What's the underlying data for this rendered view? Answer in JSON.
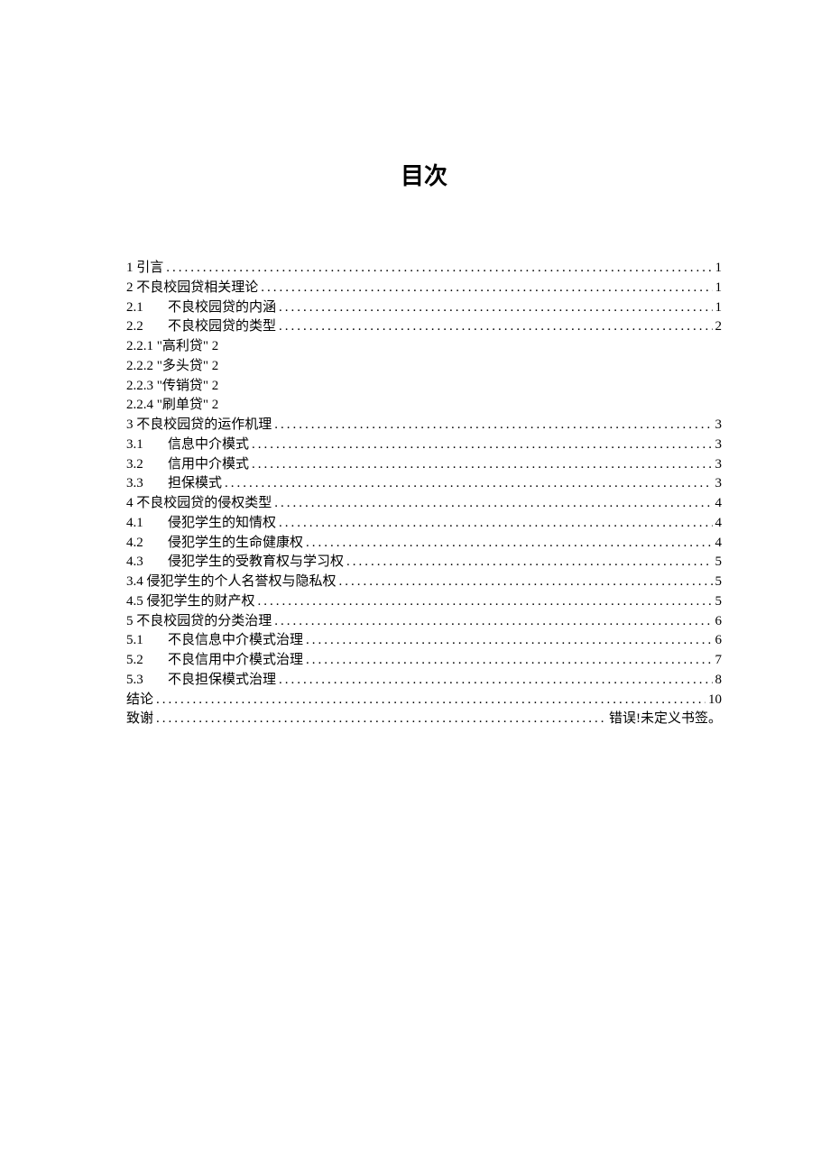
{
  "title": "目次",
  "toc": [
    {
      "label": "1 引言",
      "page": "1",
      "leaders": true
    },
    {
      "label": "2 不良校园贷相关理论",
      "page": "1",
      "leaders": true
    },
    {
      "label_num": "2.1",
      "label_text": "不良校园贷的内涵",
      "page": "1",
      "leaders": true,
      "indent": true
    },
    {
      "label_num": "2.2",
      "label_text": "不良校园贷的类型",
      "page": "2",
      "leaders": true,
      "indent": true
    },
    {
      "label": "2.2.1  \"高利贷\" 2",
      "leaders": false
    },
    {
      "label": "2.2.2  \"多头贷\" 2",
      "leaders": false
    },
    {
      "label": "2.2.3  \"传销贷\" 2",
      "leaders": false
    },
    {
      "label": "2.2.4  \"刷单贷\" 2",
      "leaders": false
    },
    {
      "label": "3 不良校园贷的运作机理",
      "page": "3",
      "leaders": true
    },
    {
      "label_num": "3.1",
      "label_text": "信息中介模式",
      "page": "3",
      "leaders": true,
      "indent": true
    },
    {
      "label_num": "3.2",
      "label_text": "信用中介模式",
      "page": "3",
      "leaders": true,
      "indent": true
    },
    {
      "label_num": "3.3",
      "label_text": "担保模式",
      "page": "3",
      "leaders": true,
      "indent": true
    },
    {
      "label": "4 不良校园贷的侵权类型",
      "page": "4",
      "leaders": true
    },
    {
      "label_num": "4.1",
      "label_text": "侵犯学生的知情权",
      "page": "4",
      "leaders": true,
      "indent": true
    },
    {
      "label_num": "4.2",
      "label_text": "侵犯学生的生命健康权",
      "page": "4",
      "leaders": true,
      "indent": true
    },
    {
      "label_num": "4.3",
      "label_text": "侵犯学生的受教育权与学习权",
      "page": "5",
      "leaders": true,
      "indent": true
    },
    {
      "label": "3.4 侵犯学生的个人名誉权与隐私权",
      "page": "5",
      "leaders": true
    },
    {
      "label": "4.5 侵犯学生的财产权",
      "page": "5",
      "leaders": true
    },
    {
      "label": "5 不良校园贷的分类治理",
      "page": "6",
      "leaders": true
    },
    {
      "label_num": "5.1",
      "label_text": "不良信息中介模式治理",
      "page": "6",
      "leaders": true,
      "indent": true
    },
    {
      "label_num": "5.2",
      "label_text": "不良信用中介模式治理",
      "page": "7",
      "leaders": true,
      "indent": true
    },
    {
      "label_num": "5.3",
      "label_text": "不良担保模式治理",
      "page": "8",
      "leaders": true,
      "indent": true
    },
    {
      "label": "结论",
      "page": "10",
      "leaders": true
    },
    {
      "label": "致谢",
      "page": "错误!未定义书签。",
      "leaders": true
    }
  ]
}
